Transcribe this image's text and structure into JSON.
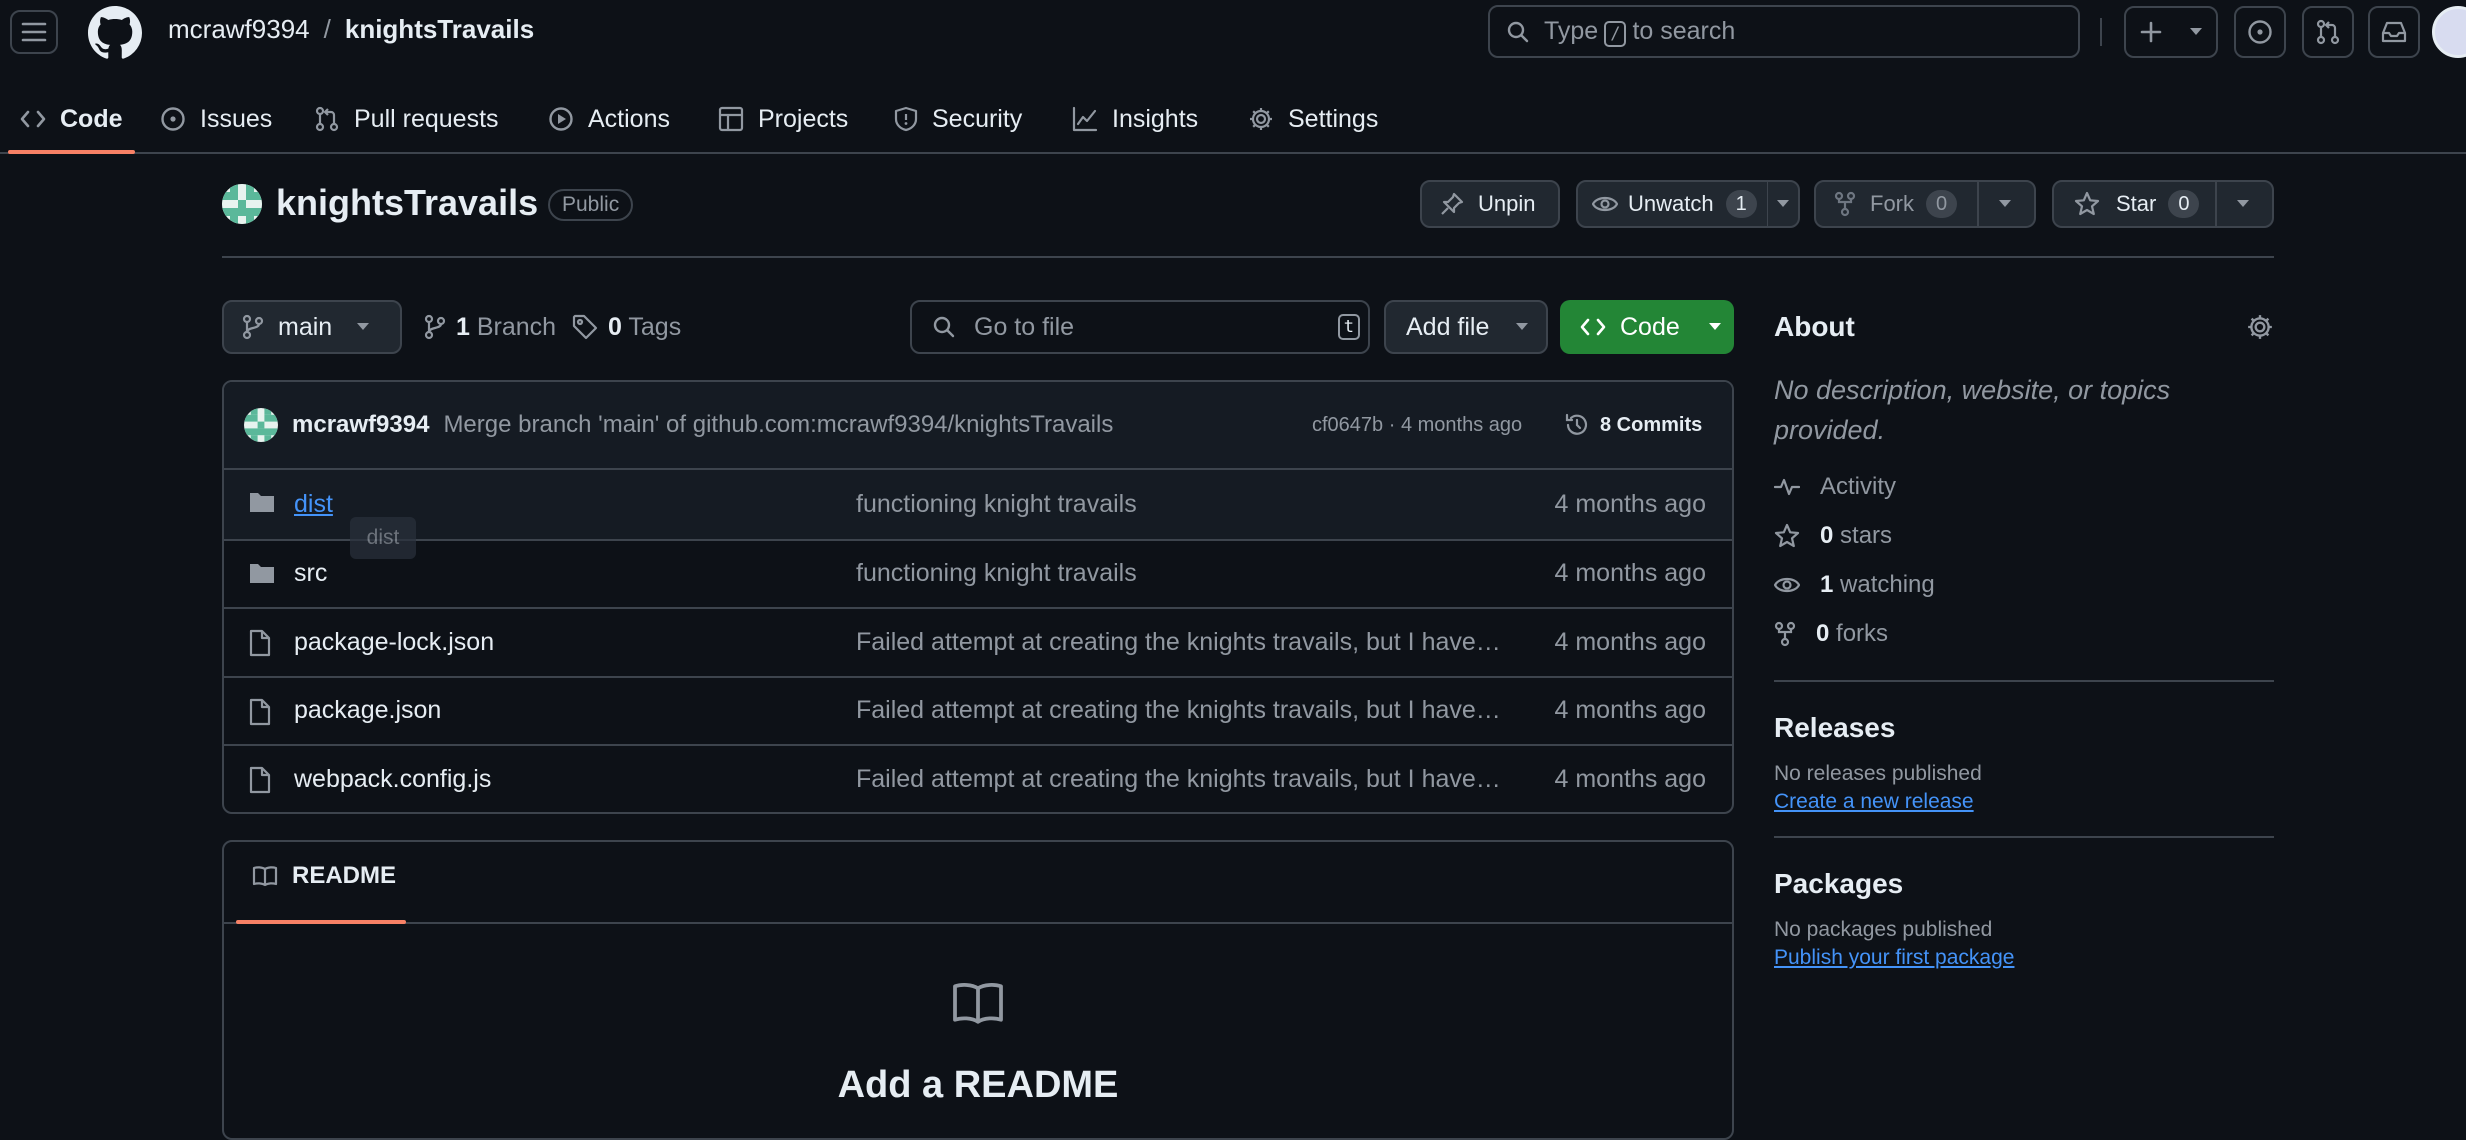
{
  "header": {
    "owner": "mcrawf9394",
    "separator": "/",
    "repo": "knightsTravails",
    "search_prefix": "Type",
    "search_key": "/",
    "search_suffix": "to search"
  },
  "nav": {
    "tabs": [
      {
        "label": "Code",
        "icon": "code-icon",
        "active": true
      },
      {
        "label": "Issues",
        "icon": "issue-icon"
      },
      {
        "label": "Pull requests",
        "icon": "pull-request-icon"
      },
      {
        "label": "Actions",
        "icon": "play-icon"
      },
      {
        "label": "Projects",
        "icon": "table-icon"
      },
      {
        "label": "Security",
        "icon": "shield-icon"
      },
      {
        "label": "Insights",
        "icon": "graph-icon"
      },
      {
        "label": "Settings",
        "icon": "gear-icon"
      }
    ]
  },
  "repo": {
    "name": "knightsTravails",
    "visibility": "Public",
    "unpin_label": "Unpin",
    "unwatch_label": "Unwatch",
    "watch_count": "1",
    "fork_label": "Fork",
    "fork_count": "0",
    "star_label": "Star",
    "star_count": "0"
  },
  "browser": {
    "branch": "main",
    "branch_count": "1",
    "branch_label": "Branch",
    "tag_count": "0",
    "tag_label": "Tags",
    "goto_placeholder": "Go to file",
    "goto_key": "t",
    "add_file_label": "Add file",
    "code_label": "Code"
  },
  "commit": {
    "author": "mcrawf9394",
    "message": "Merge branch 'main' of github.com:mcrawf9394/knightsTravails",
    "meta": "cf0647b · 4 months ago",
    "commits_label": "8 Commits"
  },
  "files": [
    {
      "name": "dist",
      "type": "folder",
      "message": "functioning knight travails",
      "date": "4 months ago"
    },
    {
      "name": "src",
      "type": "folder",
      "message": "functioning knight travails",
      "date": "4 months ago"
    },
    {
      "name": "package-lock.json",
      "type": "file",
      "message": "Failed attempt at creating the knights travails, but I have a much better…",
      "date": "4 months ago"
    },
    {
      "name": "package.json",
      "type": "file",
      "message": "Failed attempt at creating the knights travails, but I have a much better…",
      "date": "4 months ago"
    },
    {
      "name": "webpack.config.js",
      "type": "file",
      "message": "Failed attempt at creating the knights travails, but I have a much better…",
      "date": "4 months ago"
    }
  ],
  "tooltip": "dist",
  "readme": {
    "tab_label": "README",
    "heading": "Add a README"
  },
  "about": {
    "title": "About",
    "description": "No description, website, or topics provided.",
    "activity_label": "Activity",
    "stars_count": "0",
    "stars_label": "stars",
    "watching_count": "1",
    "watching_label": "watching",
    "forks_count": "0",
    "forks_label": "forks"
  },
  "releases": {
    "title": "Releases",
    "empty": "No releases published",
    "link": "Create a new release"
  },
  "packages": {
    "title": "Packages",
    "empty": "No packages published",
    "link": "Publish your first package"
  },
  "colors": {
    "accent_green": "#238636",
    "link_blue": "#4493f8",
    "tab_underline": "#f78166"
  }
}
